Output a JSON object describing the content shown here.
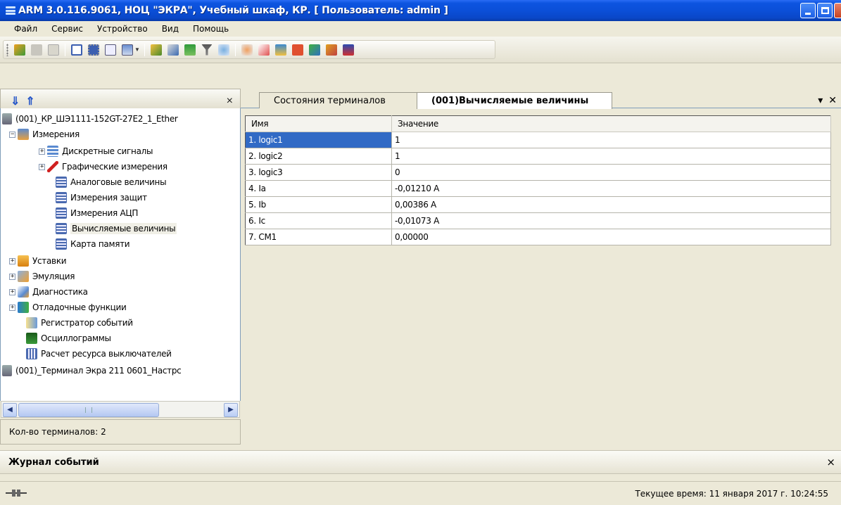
{
  "window": {
    "title": "ARM 3.0.116.9061, НОЦ \"ЭКРА\", Учебный шкаф, КР. [ Пользователь: admin ]"
  },
  "menu": [
    "Файл",
    "Сервис",
    "Устройство",
    "Вид",
    "Помощь"
  ],
  "left_panel": {
    "close_label": "×",
    "tree": {
      "root1": "(001)_КР_ШЭ1111-152GT-27E2_1_Ether",
      "izmereniya": "Измерения",
      "diskretnye": "Дискретные сигналы",
      "graficheskie": "Графические измерения",
      "analogovye": "Аналоговые величины",
      "zaschit": "Измерения защит",
      "acp": "Измерения АЦП",
      "vychislyaemye": "Вычисляемые величины",
      "karta": "Карта памяти",
      "ustavki": "Уставки",
      "emulyaciya": "Эмуляция",
      "diagnostika": "Диагностика",
      "otladochnye": "Отладочные функции",
      "registrator": "Регистратор событий",
      "oscillogrammy": "Осциллограммы",
      "raschet": "Расчет ресурса выключателей",
      "root2": "(001)_Терминал Экра 211 0601_Настрс"
    },
    "status": "Кол-во терминалов: 2"
  },
  "tabs": [
    {
      "label": "Состояния терминалов"
    },
    {
      "label": "(001)Вычисляемые величины"
    }
  ],
  "table": {
    "headers": [
      "Имя",
      "Значение"
    ],
    "rows": [
      {
        "name": "1. logic1",
        "value": "1"
      },
      {
        "name": "2. logic2",
        "value": "1"
      },
      {
        "name": "3. logic3",
        "value": "0"
      },
      {
        "name": "4. Ia",
        "value": "-0,01210 A"
      },
      {
        "name": "5. Ib",
        "value": "0,00386 A"
      },
      {
        "name": "6. Ic",
        "value": "-0,01073 A"
      },
      {
        "name": "7. CM1",
        "value": "0,00000"
      }
    ]
  },
  "journal": {
    "title": "Журнал событий",
    "close_label": "×"
  },
  "statusbar": {
    "time": "Текущее время: 11 января 2017 г. 10:24:55"
  },
  "colors": {
    "titlebar": "#0b4fd8",
    "selection": "#316ac5",
    "chrome": "#ece9d8"
  }
}
